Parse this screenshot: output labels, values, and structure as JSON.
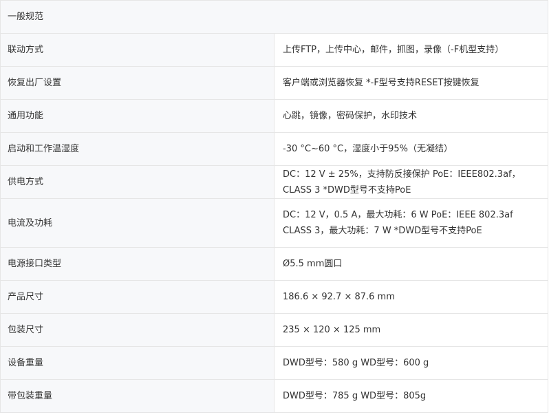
{
  "section": {
    "title": "一般规范"
  },
  "rows": [
    {
      "label": "联动方式",
      "value": "上传FTP，上传中心，邮件，抓图，录像（-F机型支持）"
    },
    {
      "label": "恢复出厂设置",
      "value": "客户端或浏览器恢复 *-F型号支持RESET按键恢复"
    },
    {
      "label": "通用功能",
      "value": "心跳，镜像，密码保护，水印技术"
    },
    {
      "label": "启动和工作温湿度",
      "value": "-30 °C~60 °C，湿度小于95%（无凝结）"
    },
    {
      "label": "供电方式",
      "value": "DC：12 V ± 25%，支持防反接保护 PoE：IEEE802.3af，CLASS 3 *DWD型号不支持PoE"
    },
    {
      "label": "电流及功耗",
      "value": "DC：12 V，0.5 A，最大功耗：6 W PoE：IEEE 802.3af CLASS 3，最大功耗：7 W *DWD型号不支持PoE"
    },
    {
      "label": "电源接口类型",
      "value": "Ø5.5 mm圆口"
    },
    {
      "label": "产品尺寸",
      "value": "186.6 × 92.7 × 87.6 mm"
    },
    {
      "label": "包装尺寸",
      "value": "235 × 120 × 125 mm"
    },
    {
      "label": "设备重量",
      "value": "DWD型号：580 g WD型号：600 g"
    },
    {
      "label": "带包装重量",
      "value": "DWD型号：785 g WD型号：805g"
    }
  ]
}
